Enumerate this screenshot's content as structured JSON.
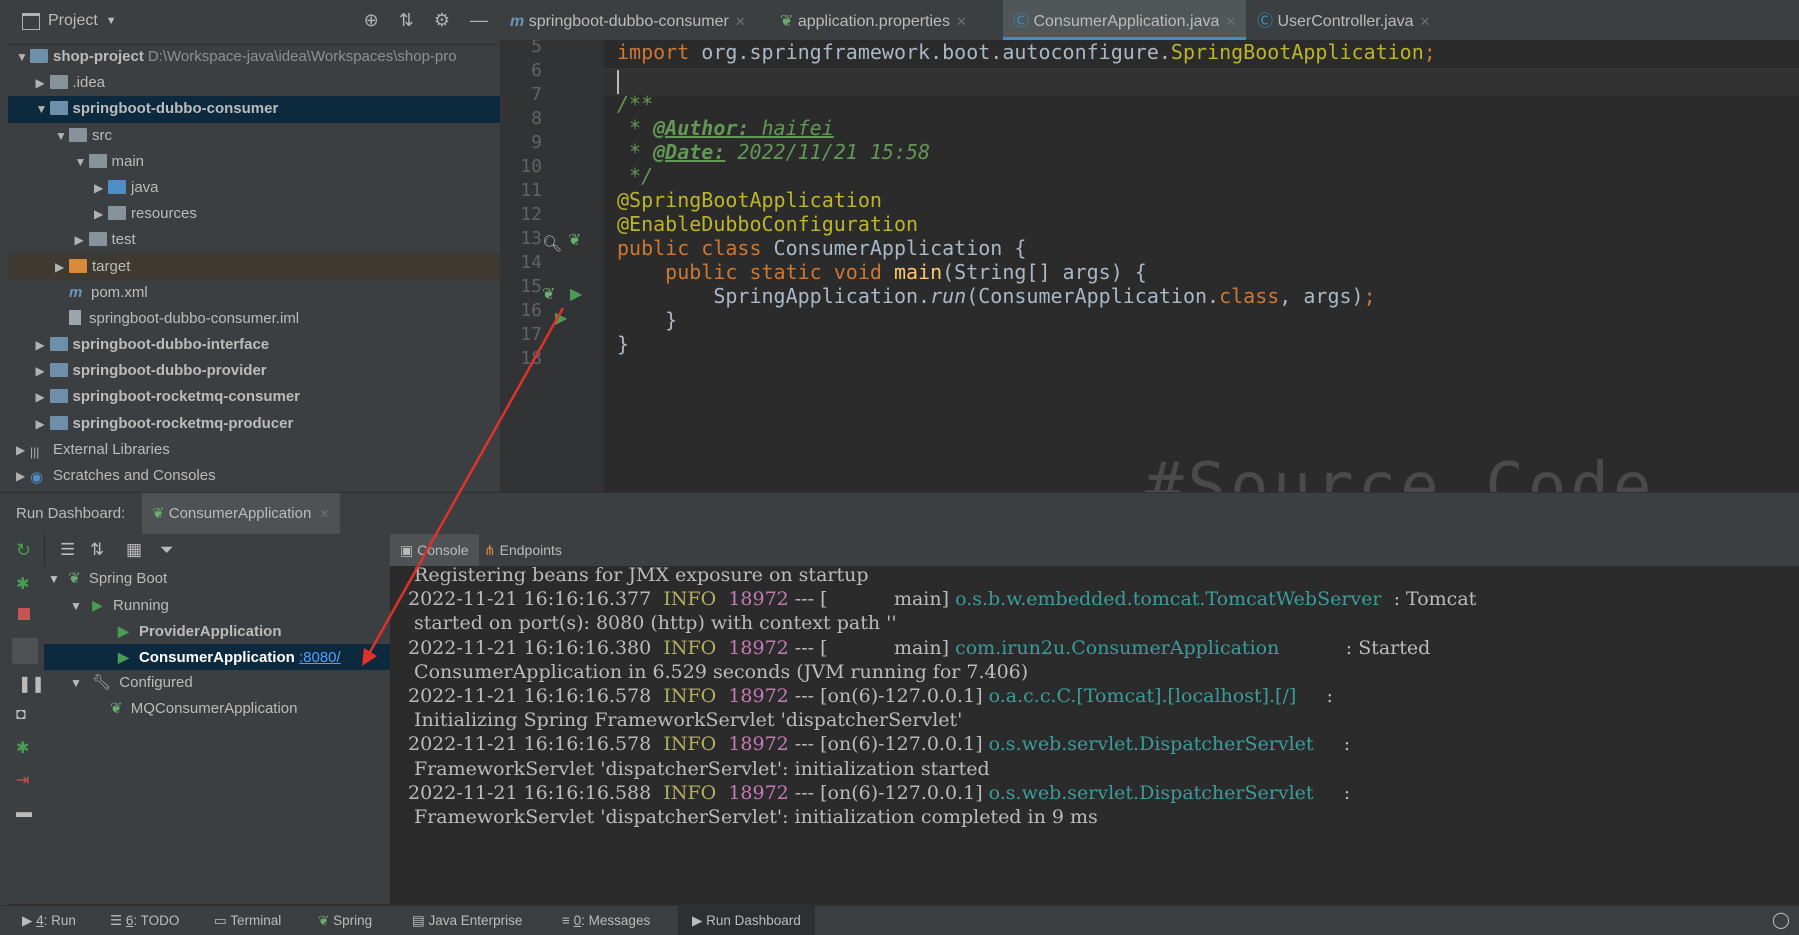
{
  "project_panel": {
    "title": "Project",
    "tree": [
      {
        "label": "shop-project",
        "path": "D:\\Workspace-java\\idea\\Workspaces\\shop-pro",
        "depth": 0,
        "expanded": true,
        "kind": "module"
      },
      {
        "label": ".idea",
        "depth": 1,
        "expanded": false,
        "kind": "folder"
      },
      {
        "label": "springboot-dubbo-consumer",
        "depth": 1,
        "expanded": true,
        "kind": "module",
        "selected": true
      },
      {
        "label": "src",
        "depth": 2,
        "expanded": true,
        "kind": "folder"
      },
      {
        "label": "main",
        "depth": 3,
        "expanded": true,
        "kind": "folder"
      },
      {
        "label": "java",
        "depth": 4,
        "expanded": false,
        "kind": "folder-blue"
      },
      {
        "label": "resources",
        "depth": 4,
        "expanded": false,
        "kind": "folder"
      },
      {
        "label": "test",
        "depth": 3,
        "expanded": false,
        "kind": "folder"
      },
      {
        "label": "target",
        "depth": 2,
        "expanded": false,
        "kind": "folder-orange"
      },
      {
        "label": "pom.xml",
        "depth": 2,
        "kind": "maven"
      },
      {
        "label": "springboot-dubbo-consumer.iml",
        "depth": 2,
        "kind": "file"
      },
      {
        "label": "springboot-dubbo-interface",
        "depth": 1,
        "expanded": false,
        "kind": "module"
      },
      {
        "label": "springboot-dubbo-provider",
        "depth": 1,
        "expanded": false,
        "kind": "module"
      },
      {
        "label": "springboot-rocketmq-consumer",
        "depth": 1,
        "expanded": false,
        "kind": "module"
      },
      {
        "label": "springboot-rocketmq-producer",
        "depth": 1,
        "expanded": false,
        "kind": "module"
      },
      {
        "label": "External Libraries",
        "depth": 0,
        "expanded": false,
        "kind": "library"
      },
      {
        "label": "Scratches and Consoles",
        "depth": 0,
        "expanded": false,
        "kind": "scratch"
      }
    ]
  },
  "editor": {
    "tabs": [
      {
        "label": "springboot-dubbo-consumer",
        "icon": "maven-icon"
      },
      {
        "label": "application.properties",
        "icon": "spring-leaf-icon"
      },
      {
        "label": "ConsumerApplication.java",
        "icon": "class-icon",
        "active": true
      },
      {
        "label": "UserController.java",
        "icon": "class-icon"
      }
    ],
    "line_numbers": [
      "5",
      "6",
      "7",
      "8",
      "9",
      "10",
      "11",
      "12",
      "13",
      "14",
      "15",
      "16",
      "17",
      "18"
    ],
    "code": {
      "l5_kw": "import ",
      "l5_pkg": "org.springframework.boot.autoconfigure.",
      "l5_cls": "SpringBootApplication",
      "l5_semi": ";",
      "l7": "/**",
      "l8_pre": " * ",
      "l8_tag": "@Author:",
      "l8_val": " haifei",
      "l9_pre": " * ",
      "l9_tag": "@Date:",
      "l9_val": " 2022/11/21 15:58",
      "l10": " */",
      "l11": "@SpringBootApplication",
      "l12": "@EnableDubboConfiguration",
      "l13_kw": "public class ",
      "l13_name": "ConsumerApplication {",
      "l14_kw": "    public static void ",
      "l14_fn": "main",
      "l14_rest": "(String[] args) {",
      "l15_a": "        SpringApplication.",
      "l15_run": "run",
      "l15_b": "(ConsumerApplication.",
      "l15_cls": "class",
      "l15_c": ", args)",
      "l15_semi": ";",
      "l16": "    }",
      "l17": "}"
    },
    "watermark": "#Source Code"
  },
  "run_dashboard": {
    "title": "Run Dashboard:",
    "config_tab": "ConsumerApplication",
    "tree": {
      "spring_boot": "Spring Boot",
      "running": "Running",
      "provider": "ProviderApplication",
      "consumer": "ConsumerApplication",
      "consumer_port": ":8080/",
      "configured": "Configured",
      "mq_consumer": "MQConsumerApplication"
    },
    "console_tabs": [
      "Console",
      "Endpoints"
    ],
    "console_lines": [
      {
        "text": " Registering beans for JMX exposure on startup"
      },
      {
        "date": "2022-11-21 16:16:16.377",
        "level": "INFO",
        "pid": "18972",
        "sep": " --- [",
        "thread": "           main]",
        "logger": " o.s.b.w.embedded.tomcat.TomcatWebServer",
        "tail": "  : Tomcat"
      },
      {
        "text": " started on port(s): 8080 (http) with context path ''"
      },
      {
        "date": "2022-11-21 16:16:16.380",
        "level": "INFO",
        "pid": "18972",
        "sep": " --- [",
        "thread": "           main]",
        "logger": " com.irun2u.ConsumerApplication",
        "tail": "           : Started"
      },
      {
        "text": " ConsumerApplication in 6.529 seconds (JVM running for 7.406)"
      },
      {
        "date": "2022-11-21 16:16:16.578",
        "level": "INFO",
        "pid": "18972",
        "sep": " --- [",
        "thread": "on(6)-127.0.0.1]",
        "logger": " o.a.c.c.C.[Tomcat].[localhost].[/]",
        "tail": "     :"
      },
      {
        "text": " Initializing Spring FrameworkServlet 'dispatcherServlet'"
      },
      {
        "date": "2022-11-21 16:16:16.578",
        "level": "INFO",
        "pid": "18972",
        "sep": " --- [",
        "thread": "on(6)-127.0.0.1]",
        "logger": " o.s.web.servlet.DispatcherServlet",
        "tail": "     :"
      },
      {
        "text": " FrameworkServlet 'dispatcherServlet': initialization started"
      },
      {
        "date": "2022-11-21 16:16:16.588",
        "level": "INFO",
        "pid": "18972",
        "sep": " --- [",
        "thread": "on(6)-127.0.0.1]",
        "logger": " o.s.web.servlet.DispatcherServlet",
        "tail": "     :"
      },
      {
        "text": " FrameworkServlet 'dispatcherServlet': initialization completed in 9 ms"
      }
    ]
  },
  "status_bar": {
    "items": [
      {
        "num": "4",
        "label": ": Run"
      },
      {
        "num": "6",
        "label": ": TODO"
      },
      {
        "num": "",
        "label": "Terminal"
      },
      {
        "num": "",
        "label": "Spring"
      },
      {
        "num": "",
        "label": "Java Enterprise"
      },
      {
        "num": "0",
        "label": ": Messages"
      },
      {
        "num": "",
        "label": "Run Dashboard",
        "active": true
      }
    ]
  },
  "colors": {
    "accent": "#4a88c7",
    "selection": "#0d293e",
    "info": "#b3ae60",
    "logger": "#3b9c9c",
    "annotation_arrow": "#e0322c"
  }
}
